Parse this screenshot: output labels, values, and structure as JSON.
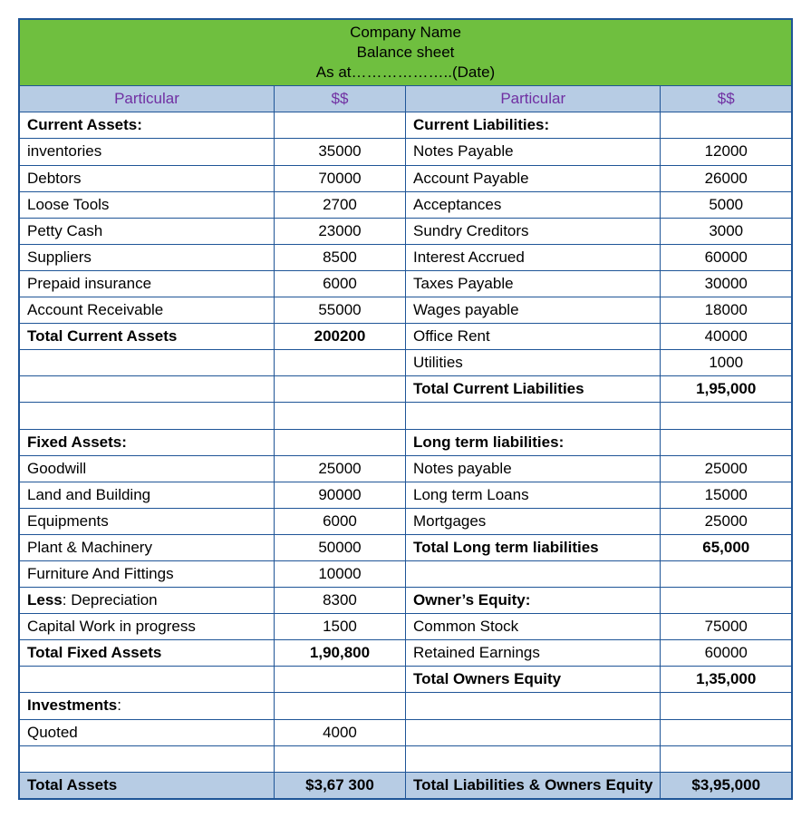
{
  "header": {
    "line1": "Company Name",
    "line2": "Balance sheet",
    "line3": "As at………………..(Date)"
  },
  "columns": {
    "left_particular": "Particular",
    "left_amount": "$$",
    "right_particular": "Particular",
    "right_amount": "$$"
  },
  "left": {
    "current_assets_heading": "Current Assets:",
    "current_assets": [
      {
        "label": "inventories",
        "value": "35000"
      },
      {
        "label": "Debtors",
        "value": "70000"
      },
      {
        "label": "Loose Tools",
        "value": "2700"
      },
      {
        "label": "Petty Cash",
        "value": "23000"
      },
      {
        "label": "Suppliers",
        "value": "8500"
      },
      {
        "label": "Prepaid insurance",
        "value": "6000"
      },
      {
        "label": "Account Receivable",
        "value": "55000"
      }
    ],
    "total_current_label": "Total Current Assets",
    "total_current_value": "200200",
    "fixed_assets_heading": "Fixed Assets:",
    "fixed_assets": [
      {
        "label": "Goodwill",
        "value": "25000"
      },
      {
        "label": "Land and Building",
        "value": "90000"
      },
      {
        "label": "Equipments",
        "value": "6000"
      },
      {
        "label": "Plant & Machinery",
        "value": "50000"
      },
      {
        "label": "Furniture And Fittings",
        "value": "10000"
      }
    ],
    "less_label_prefix": "Less",
    "less_label_suffix": ": Depreciation",
    "less_value": "8300",
    "cwip_label": "Capital Work in progress",
    "cwip_value": "1500",
    "total_fixed_label": "Total Fixed Assets",
    "total_fixed_value": "1,90,800",
    "investments_heading_prefix": "Investments",
    "investments_heading_suffix": ":",
    "investments": [
      {
        "label": "Quoted",
        "value": "4000"
      }
    ],
    "total_assets_label": "Total Assets",
    "total_assets_value": "$3,67 300"
  },
  "right": {
    "current_liab_heading": "Current Liabilities:",
    "current_liab": [
      {
        "label": "Notes Payable",
        "value": "12000"
      },
      {
        "label": "Account Payable",
        "value": "26000"
      },
      {
        "label": "Acceptances",
        "value": "5000"
      },
      {
        "label": "Sundry Creditors",
        "value": "3000"
      },
      {
        "label": "Interest Accrued",
        "value": "60000"
      },
      {
        "label": "Taxes Payable",
        "value": "30000"
      },
      {
        "label": "Wages payable",
        "value": "18000"
      },
      {
        "label": "Office Rent",
        "value": "40000"
      },
      {
        "label": "Utilities",
        "value": "1000"
      }
    ],
    "total_current_liab_label": "Total Current Liabilities",
    "total_current_liab_value": "1,95,000",
    "long_term_heading": "Long term liabilities:",
    "long_term": [
      {
        "label": "Notes payable",
        "value": "25000"
      },
      {
        "label": "Long term Loans",
        "value": "15000"
      },
      {
        "label": "Mortgages",
        "value": "25000"
      }
    ],
    "total_long_label": "Total Long term liabilities",
    "total_long_value": "65,000",
    "equity_heading": "Owner’s Equity:",
    "equity": [
      {
        "label": "Common Stock",
        "value": "75000"
      },
      {
        "label": "Retained Earnings",
        "value": "60000"
      }
    ],
    "total_equity_label": "Total Owners Equity",
    "total_equity_value": "1,35,000",
    "total_liab_equity_label": "Total Liabilities & Owners Equity",
    "total_liab_equity_value": "$3,95,000"
  }
}
